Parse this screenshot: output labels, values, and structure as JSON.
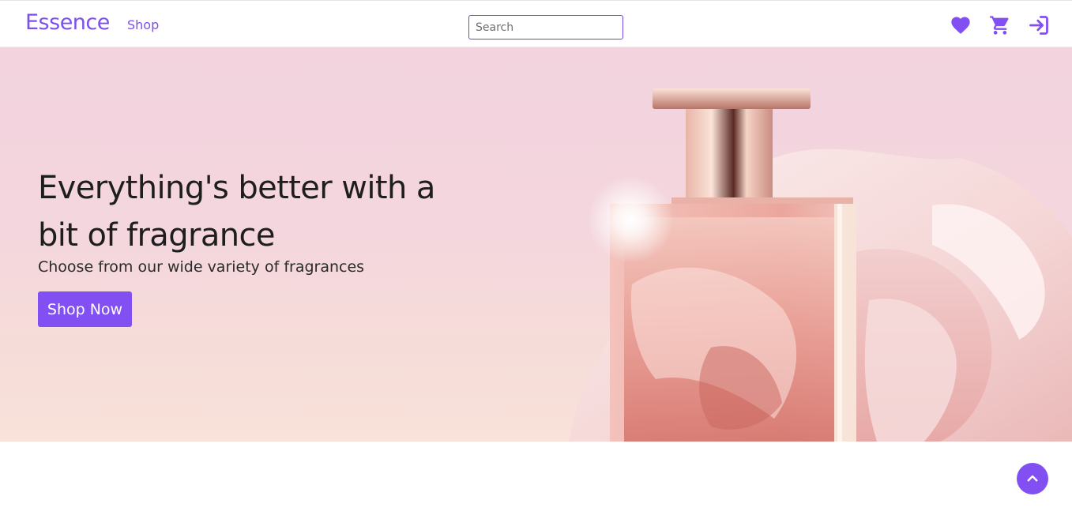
{
  "navbar": {
    "brand": "Essence",
    "shop_link": "Shop",
    "search_placeholder": "Search",
    "icons": [
      "heart-icon",
      "cart-icon",
      "login-icon"
    ]
  },
  "hero": {
    "title": "Everything's better with a bit of fragrance",
    "subtitle": "Choose from our wide variety of fragrances",
    "cta_label": "Shop Now"
  },
  "back_to_top": {
    "icon": "chevron-up-icon"
  },
  "colors": {
    "accent": "#8250f2",
    "brand_text": "#7b4ff1",
    "hero_bg": "#f3d5de",
    "heading_text": "#1e1e1e"
  }
}
